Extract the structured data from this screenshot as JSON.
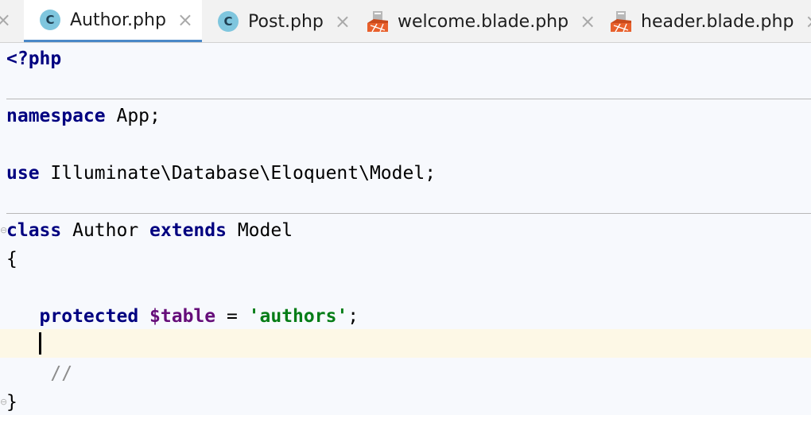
{
  "tabs": [
    {
      "label": "Author.php",
      "icon": "class-icon",
      "icon_glyph": "C"
    },
    {
      "label": "Post.php",
      "icon": "class-icon",
      "icon_glyph": "C"
    },
    {
      "label": "welcome.blade.php",
      "icon": "blade-file-icon"
    },
    {
      "label": "header.blade.php",
      "icon": "blade-file-icon"
    }
  ],
  "close_glyph": "×",
  "code": {
    "open_tag": "<?php",
    "namespace_kw": "namespace",
    "namespace_name": " App;",
    "use_kw": "use",
    "use_path": " Illuminate\\Database\\Eloquent\\Model;",
    "class_kw": "class",
    "class_name": " Author ",
    "extends_kw": "extends",
    "parent_name": " Model",
    "brace_open": "{",
    "indent": "   ",
    "protected_kw": "protected",
    "space": " ",
    "table_var": "$table",
    "assign": " = ",
    "table_value": "'authors'",
    "semicolon": ";",
    "comment": "    //",
    "brace_close": "}"
  },
  "colors": {
    "keyword": "#000080",
    "variable": "#660e7a",
    "string": "#067d17",
    "active_tab_underline": "#4a88c7",
    "current_line": "#fdf8e6"
  }
}
